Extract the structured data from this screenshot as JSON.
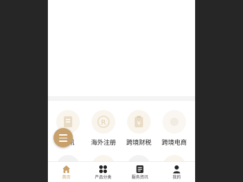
{
  "colors": {
    "accent": "#c7a06b",
    "icon_circle_bg": "#f9f4ec",
    "side_bg": "#262626",
    "text": "#222222"
  },
  "services": [
    {
      "label": "资讯",
      "icon": "document-icon"
    },
    {
      "label": "海外注册",
      "icon": "registered-icon"
    },
    {
      "label": "跨境财税",
      "icon": "tax-icon"
    },
    {
      "label": "跨境电商",
      "icon": "ecommerce-icon"
    }
  ],
  "fab": {
    "icon": "menu-icon"
  },
  "tabbar": {
    "items": [
      {
        "label": "首页",
        "icon": "home-icon",
        "active": true
      },
      {
        "label": "产品分类",
        "icon": "grid-icon",
        "active": false
      },
      {
        "label": "服务资讯",
        "icon": "news-icon",
        "active": false
      },
      {
        "label": "我的",
        "icon": "user-icon",
        "active": false
      }
    ]
  }
}
